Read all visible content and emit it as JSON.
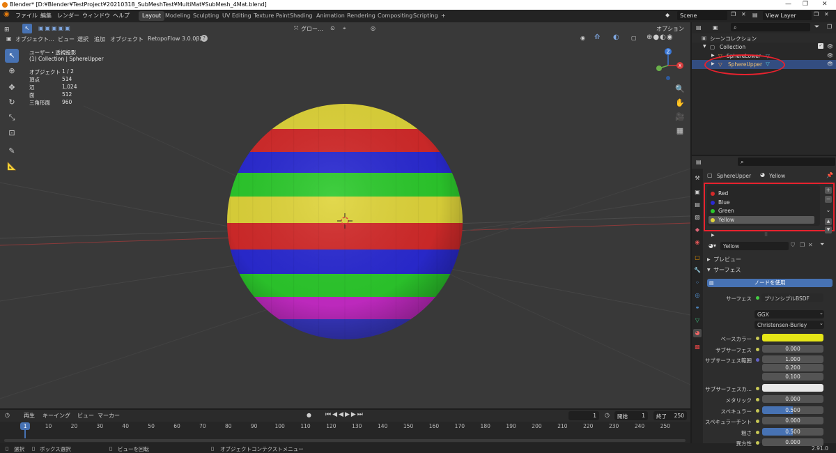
{
  "window": {
    "title": "Blender* [D:¥Blender¥TestProject¥20210318_SubMeshTest¥MultiMat¥SubMesh_4Mat.blend]",
    "minimize": "—",
    "maximize": "❐",
    "close": "✕"
  },
  "menu": {
    "items": [
      "ファイル",
      "編集",
      "レンダー",
      "ウィンドウ",
      "ヘルプ"
    ],
    "workspaces": [
      "Layout",
      "Modeling",
      "Sculpting",
      "UV Editing",
      "Texture Paint",
      "Shading",
      "Animation",
      "Rendering",
      "Compositing",
      "Scripting"
    ],
    "scene": "Scene",
    "view_layer": "View Layer"
  },
  "viewport": {
    "mode": "オブジェクト...",
    "menus": [
      "ビュー",
      "選択",
      "追加",
      "オブジェクト"
    ],
    "addon": "RetopoFlow 3.0.0β2",
    "transform": "グロー...",
    "options": "オプション",
    "view_name": "ユーザー・透視投影",
    "collection_info": "(1) Collection | SphereUpper",
    "stats": [
      {
        "label": "オブジェクト",
        "value": "1 / 2"
      },
      {
        "label": "頂点",
        "value": "514"
      },
      {
        "label": "辺",
        "value": "1,024"
      },
      {
        "label": "面",
        "value": "512"
      },
      {
        "label": "三角形面",
        "value": "960"
      }
    ],
    "gizmo": {
      "x": "X",
      "y": "Y",
      "z": "Z"
    }
  },
  "sphere": {
    "stripes": [
      "#dfd43a",
      "#d22a2a",
      "#2a2ad2",
      "#2cc92c",
      "#dfd43a",
      "#d22a2a",
      "#2a2ad2",
      "#2cc92c",
      "#c62bc6"
    ]
  },
  "timeline": {
    "menus": [
      "再生",
      "キーイング",
      "ビュー",
      "マーカー"
    ],
    "current_frame": "1",
    "start_label": "開始",
    "start": "1",
    "end_label": "終了",
    "end": "250",
    "ticks": [
      "1",
      "10",
      "20",
      "30",
      "40",
      "50",
      "60",
      "70",
      "80",
      "90",
      "100",
      "110",
      "120",
      "130",
      "140",
      "150",
      "160",
      "170",
      "180",
      "190",
      "200",
      "210",
      "220",
      "230",
      "240",
      "250"
    ]
  },
  "statusbar": {
    "select": "選択",
    "box_select": "ボックス選択",
    "rotate_view": "ビューを回転",
    "context_menu": "オブジェクトコンテクストメニュー",
    "version": "2.91.0"
  },
  "outliner": {
    "scene_collection": "シーンコレクション",
    "collection": "Collection",
    "objects": [
      "SphereLower",
      "SphereUpper"
    ]
  },
  "properties": {
    "object": "SphereUpper",
    "material": "Yellow",
    "slots": [
      {
        "name": "Red",
        "color": "#d22a2a"
      },
      {
        "name": "Blue",
        "color": "#2a2ad2"
      },
      {
        "name": "Green",
        "color": "#2cc92c"
      },
      {
        "name": "Yellow",
        "color": "#dfd43a"
      }
    ],
    "material_name": "Yellow",
    "preview_label": "プレビュー",
    "surface_label": "サーフェス",
    "use_nodes": "ノードを使用",
    "surface_field": "サーフェス",
    "surface_value": "プリンシプルBSDF",
    "distribution": "GGX",
    "subsurface_method": "Christensen-Burley",
    "fields": [
      {
        "label": "ベースカラー",
        "value": ""
      },
      {
        "label": "サブサーフェス",
        "value": "0.000"
      },
      {
        "label": "サブサーフェス範囲",
        "value": "1.000"
      },
      {
        "label": "",
        "value": "0.200"
      },
      {
        "label": "",
        "value": "0.100"
      },
      {
        "label": "サブサーフェスカ...",
        "value": ""
      },
      {
        "label": "メタリック",
        "value": "0.000"
      },
      {
        "label": "スペキュラー",
        "value": "0.500"
      },
      {
        "label": "スペキュラーチント",
        "value": "0.000"
      },
      {
        "label": "粗さ",
        "value": "0.500"
      },
      {
        "label": "異方性",
        "value": "0.000"
      }
    ],
    "base_color": "#e6e617",
    "subsurface_color": "#e8e8e8",
    "accent": "#4772b3"
  }
}
